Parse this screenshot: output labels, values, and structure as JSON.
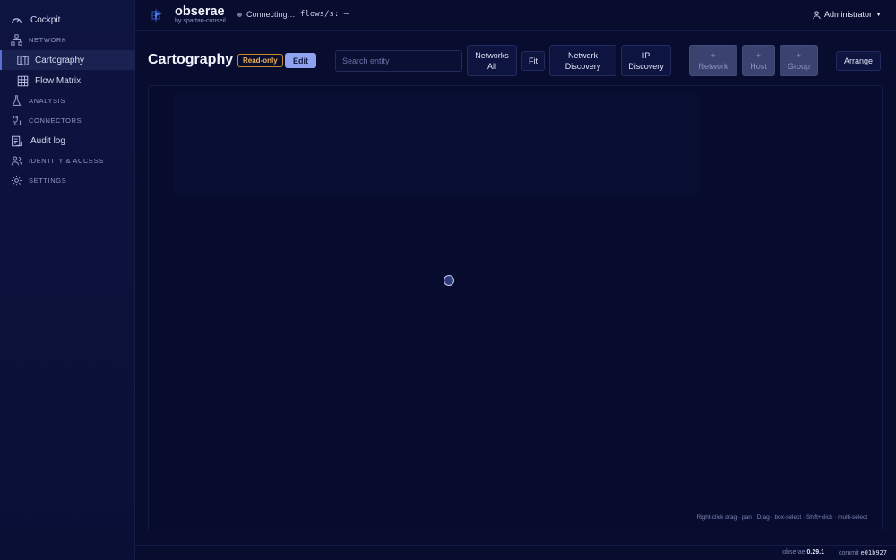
{
  "sidebar": {
    "items": [
      {
        "label": "Cockpit",
        "icon": "gauge-icon"
      },
      {
        "label": "NETWORK",
        "icon": "network-icon"
      },
      {
        "label": "Cartography",
        "icon": "map-icon"
      },
      {
        "label": "Flow Matrix",
        "icon": "grid-icon"
      },
      {
        "label": "ANALYSIS",
        "icon": "flask-icon"
      },
      {
        "label": "CONNECTORS",
        "icon": "plug-icon"
      },
      {
        "label": "Audit log",
        "icon": "ledger-icon"
      },
      {
        "label": "IDENTITY & ACCESS",
        "icon": "users-icon"
      },
      {
        "label": "SETTINGS",
        "icon": "gear-icon"
      }
    ]
  },
  "header": {
    "brand": "obserae",
    "brand_sub": "by spartan-conseil",
    "status": "Connecting…",
    "flows": "flows/s: —",
    "user": "Administrator"
  },
  "toolbar": {
    "title": "Cartography",
    "readonly_badge": "Read-only",
    "edit": "Edit",
    "search_placeholder": "Search entity",
    "networks_line1": "Networks",
    "networks_line2": "All",
    "fit": "Fit",
    "netdisc_line1": "Network",
    "netdisc_line2": "Discovery",
    "ipdisc_line1": "IP",
    "ipdisc_line2": "Discovery",
    "plus": "+",
    "add_network": "Network",
    "add_host": "Host",
    "add_group": "Group",
    "arrange": "Arrange"
  },
  "canvas": {
    "hint": "Right-click drag · pan · Drag · box-select · Shift+click · multi-select"
  },
  "footer": {
    "app_name": "obserae",
    "version": "0.29.1",
    "commit_label": "commit",
    "commit_hash": "e01b927"
  },
  "colors": {
    "background": "#080c2e",
    "accent": "#8ea2f0",
    "readonly": "#f0b25a"
  }
}
